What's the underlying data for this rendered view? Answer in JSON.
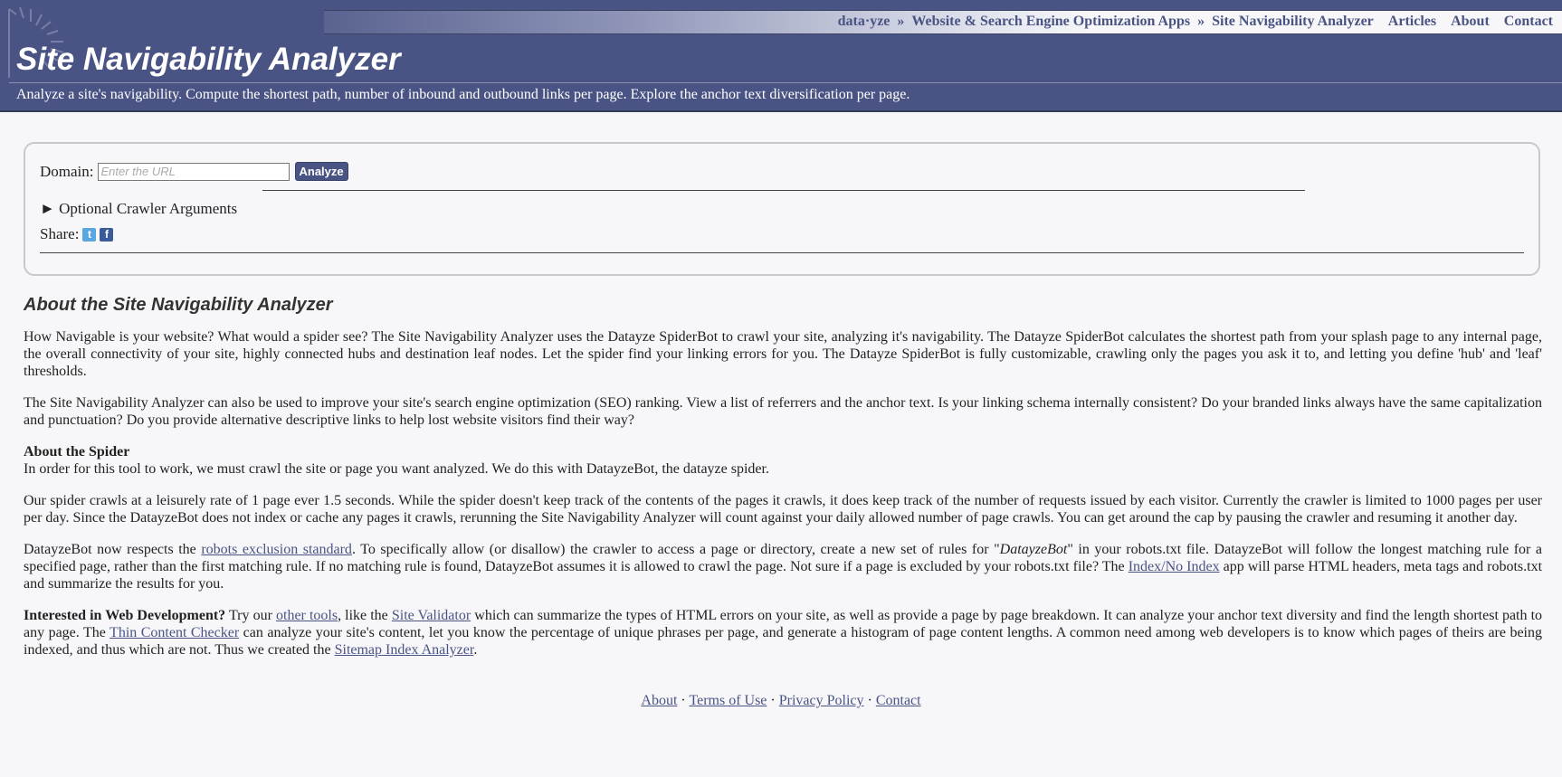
{
  "nav": {
    "brand": "data·yze",
    "sep1": "»",
    "apps": "Website & Search Engine Optimization Apps",
    "sep2": "»",
    "current": "Site Navigability Analyzer",
    "articles": "Articles",
    "about": "About",
    "contact": "Contact"
  },
  "header": {
    "title": "Site Navigability Analyzer",
    "tagline": "Analyze a site's navigability. Compute the shortest path, number of inbound and outbound links per page. Explore the anchor text diversification per page."
  },
  "form": {
    "domain_label": "Domain:",
    "domain_placeholder": "Enter the URL",
    "analyze_label": "Analyze",
    "crawler_arrow": "►",
    "crawler_label": "Optional Crawler Arguments",
    "share_label": "Share:"
  },
  "about": {
    "heading": "About the Site Navigability Analyzer",
    "p1": "How Navigable is your website? What would a spider see? The Site Navigability Analyzer uses the Datayze SpiderBot to crawl your site, analyzing it's navigability. The Datayze SpiderBot calculates the shortest path from your splash page to any internal page, the overall connectivity of your site, highly connected hubs and destination leaf nodes. Let the spider find your linking errors for you. The Datayze SpiderBot is fully customizable, crawling only the pages you ask it to, and letting you define 'hub' and 'leaf' thresholds.",
    "p2": "The Site Navigability Analyzer can also be used to improve your site's search engine optimization (SEO) ranking. View a list of referrers and the anchor text. Is your linking schema internally consistent? Do your branded links always have the same capitalization and punctuation? Do you provide alternative descriptive links to help lost website visitors find their way?",
    "spider_heading": "About the Spider",
    "spider_p1": "In order for this tool to work, we must crawl the site or page you want analyzed. We do this with DatayzeBot, the datayze spider.",
    "spider_p2": "Our spider crawls at a leisurely rate of 1 page ever 1.5 seconds. While the spider doesn't keep track of the contents of the pages it crawls, it does keep track of the number of requests issued by each visitor. Currently the crawler is limited to 1000 pages per user per day. Since the DatayzeBot does not index or cache any pages it crawls, rerunning the Site Navigability Analyzer will count against your daily allowed number of page crawls. You can get around the cap by pausing the crawler and resuming it another day.",
    "robots_a": "DatayzeBot now respects the ",
    "robots_link": "robots exclusion standard",
    "robots_b": ". To specifically allow (or disallow) the crawler to access a page or directory, create a new set of rules for \"",
    "robots_bot": "DatayzeBot",
    "robots_c": "\" in your robots.txt file. DatayzeBot will follow the longest matching rule for a specified page, rather than the first matching rule. If no matching rule is found, DatayzeBot assumes it is allowed to crawl the page. Not sure if a page is excluded by your robots.txt file? The ",
    "robots_link2": "Index/No Index",
    "robots_d": " app will parse HTML headers, meta tags and robots.txt and summarize the results for you.",
    "dev_bold": "Interested in Web Development?",
    "dev_a": " Try our ",
    "dev_link1": "other tools",
    "dev_b": ", like the ",
    "dev_link2": "Site Validator",
    "dev_c": " which can summarize the types of HTML errors on your site, as well as provide a page by page breakdown. It can analyze your anchor text diversity and find the length shortest path to any page. The ",
    "dev_link3": "Thin Content Checker",
    "dev_d": " can analyze your site's content, let you know the percentage of unique phrases per page, and generate a histogram of page content lengths. A common need among web developers is to know which pages of theirs are being indexed, and thus which are not. Thus we created the ",
    "dev_link4": "Sitemap Index Analyzer",
    "dev_e": "."
  },
  "footer": {
    "about": "About",
    "terms": "Terms of Use",
    "privacy": "Privacy Policy",
    "contact": "Contact",
    "dot": "·"
  }
}
